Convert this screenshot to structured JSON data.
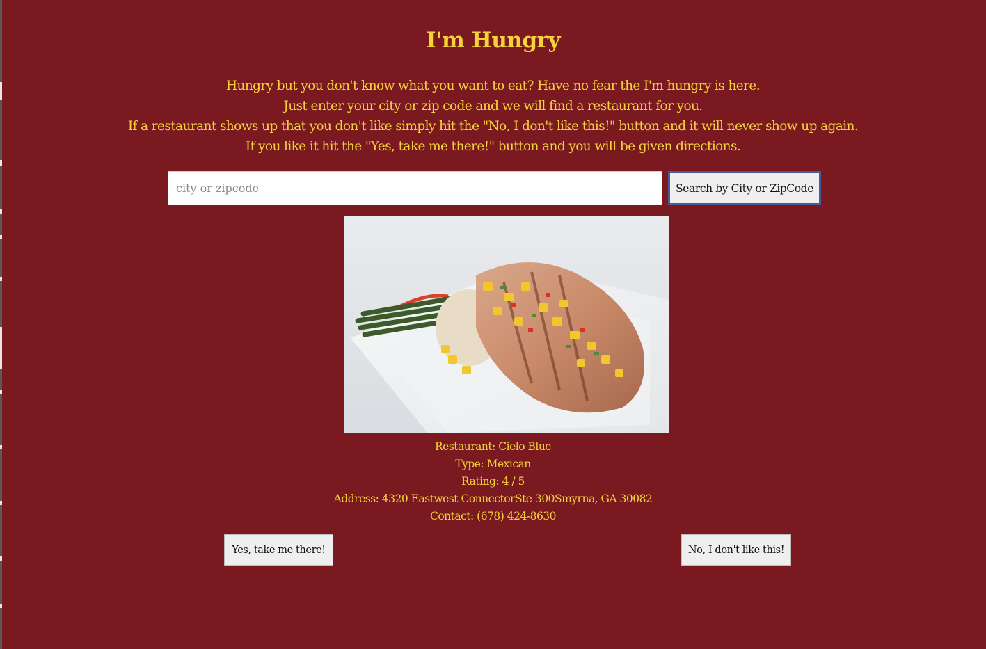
{
  "page": {
    "title": "I'm Hungry",
    "intro_lines": [
      "Hungry but you don't know what you want to eat? Have no fear the I'm hungry is here.",
      "Just enter your city or zip code and we will find a restaurant for you.",
      "If a restaurant shows up that you don't like simply hit the \"No, I don't like this!\" button and it will never show up again.",
      "If you like it hit the \"Yes, take me there!\" button and you will be given directions."
    ]
  },
  "search": {
    "value": "",
    "placeholder": "city or zipcode",
    "button_label": "Search by City or ZipCode"
  },
  "restaurant": {
    "name_line": "Restaurant: Cielo Blue",
    "type_line": "Type: Mexican",
    "rating_line": "Rating: 4 / 5",
    "address_line": "Address: 4320 Eastwest ConnectorSte 300Smyrna, GA 30082",
    "contact_line": "Contact: (678) 424-8630"
  },
  "actions": {
    "yes_label": "Yes, take me there!",
    "no_label": "No, I don't like this!"
  },
  "colors": {
    "background": "#7a1a20",
    "text_accent": "#f5d23b",
    "button_focus_border": "#4a5a95"
  }
}
